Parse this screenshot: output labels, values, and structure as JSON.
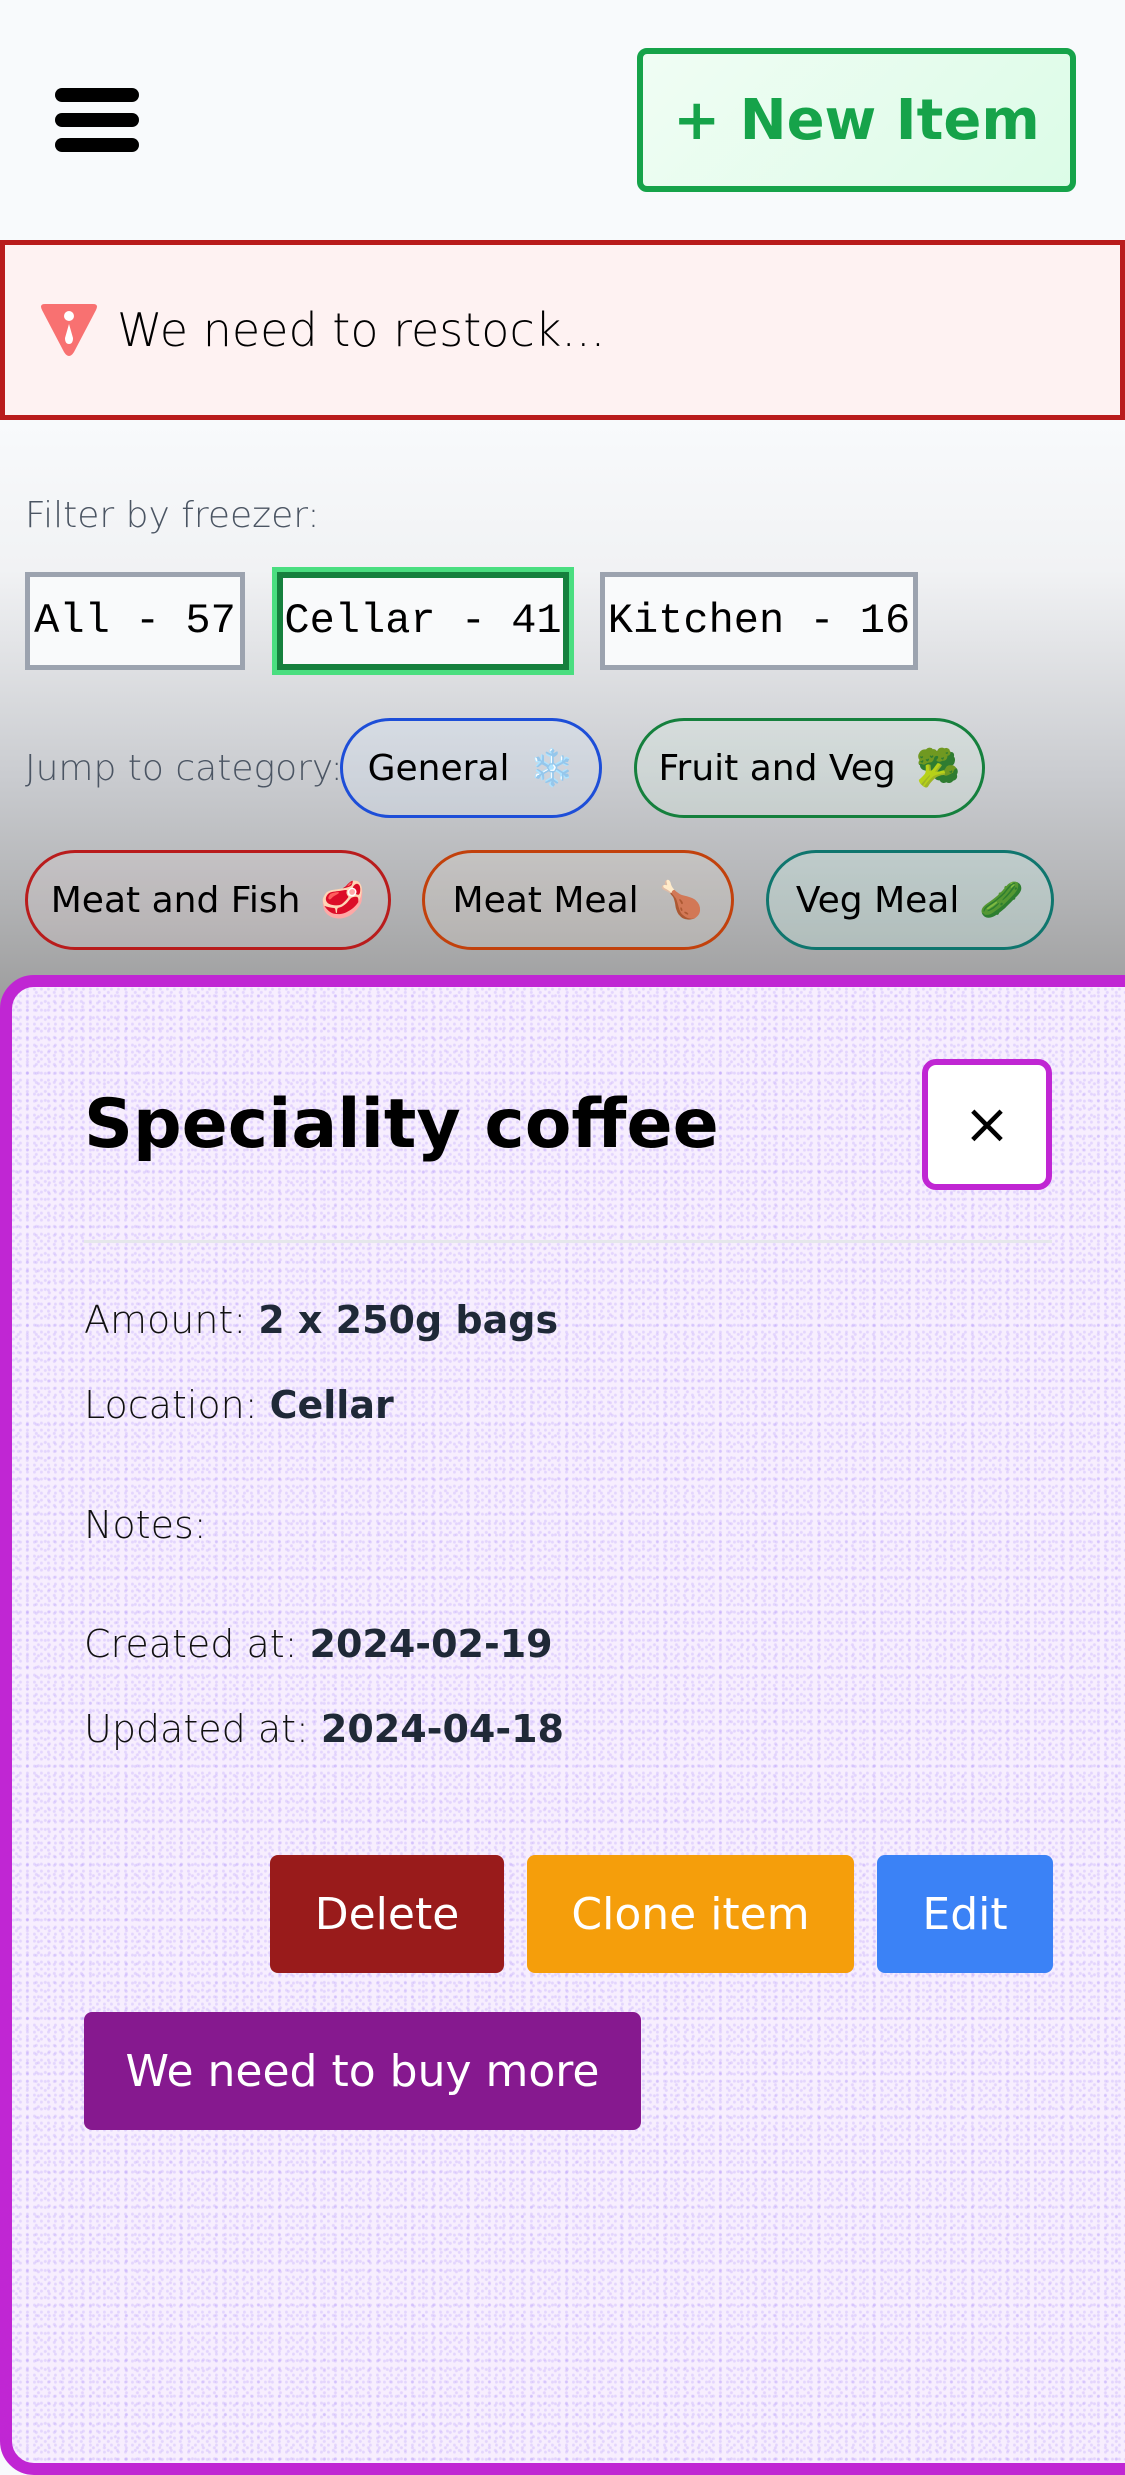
{
  "header": {
    "menu_icon": "hamburger-menu-icon",
    "new_item_label": "+ New Item"
  },
  "alert": {
    "icon": "warning-triangle-icon",
    "text": "We need to restock..."
  },
  "filter": {
    "label": "Filter by freezer:",
    "options": [
      {
        "label": "All - 57",
        "active": false
      },
      {
        "label": "Cellar - 41",
        "active": true
      },
      {
        "label": "Kitchen - 16",
        "active": false
      }
    ]
  },
  "categories": {
    "label": "Jump to category:",
    "items": [
      {
        "label": "General",
        "emoji": "❄️",
        "icon": "snowflake-icon",
        "color": "#1d4ed8"
      },
      {
        "label": "Fruit and Veg",
        "emoji": "🥦",
        "icon": "broccoli-icon",
        "color": "#15803d"
      },
      {
        "label": "Meat and Fish",
        "emoji": "🥩",
        "icon": "steak-icon",
        "color": "#b91c1c"
      },
      {
        "label": "Meat Meal",
        "emoji": "🍗",
        "icon": "drumstick-icon",
        "color": "#c2410c"
      },
      {
        "label": "Veg Meal",
        "emoji": "🥒",
        "icon": "cucumber-icon",
        "color": "#0f766e"
      }
    ]
  },
  "modal": {
    "title": "Speciality coffee",
    "close_label": "×",
    "fields": {
      "amount": {
        "label": "Amount:",
        "value": "2 x 250g bags"
      },
      "location": {
        "label": "Location:",
        "value": "Cellar"
      },
      "notes": {
        "label": "Notes:",
        "value": ""
      },
      "created": {
        "label": "Created at:",
        "value": "2024-02-19"
      },
      "updated": {
        "label": "Updated at:",
        "value": "2024-04-18"
      }
    },
    "buttons": {
      "delete": "Delete",
      "clone": "Clone item",
      "edit": "Edit",
      "buy_more": "We need to buy more"
    }
  },
  "colors": {
    "accent_green": "#16a34a",
    "alert_red": "#b91c1c",
    "modal_border": "#c026d3",
    "delete": "#991b1b",
    "clone": "#f59e0b",
    "edit": "#3b82f6",
    "buy_more": "#86198f"
  }
}
